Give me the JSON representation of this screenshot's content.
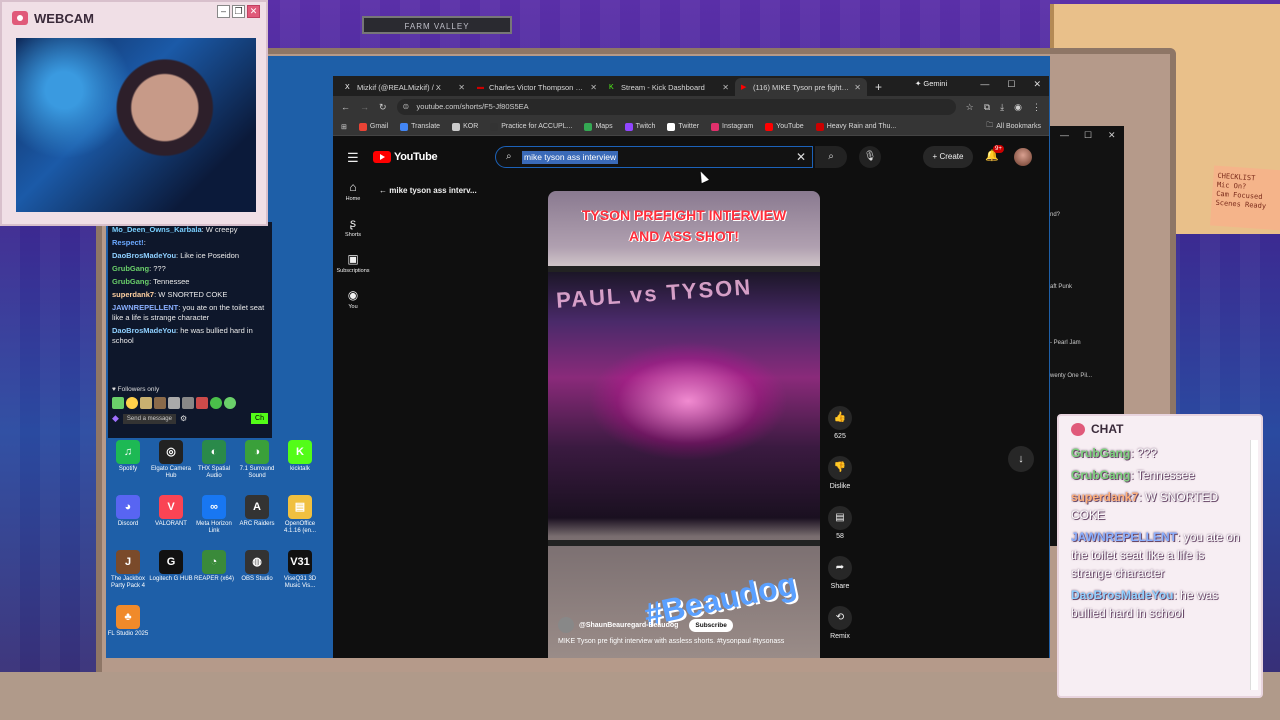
{
  "webcam": {
    "title": "WEBCAM"
  },
  "shelf_sign": "FARM VALLEY",
  "sticky_note": "CHECKLIST\nMic On?\nCam Focused\nScenes Ready",
  "browser": {
    "tabs": [
      {
        "label": "Mizkif (@REALMizkif) / X",
        "favicon": "X",
        "color": "#ffffff",
        "active": false
      },
      {
        "label": "Charles Victor Thompson Beco",
        "favicon": "▬",
        "color": "#cc0000",
        "active": false
      },
      {
        "label": "Stream - Kick Dashboard",
        "favicon": "K",
        "color": "#53fc18",
        "active": false
      },
      {
        "label": "(116) MIKE Tyson pre fight inte",
        "favicon": "▶",
        "color": "#ff0000",
        "active": true
      }
    ],
    "gemini_label": "Gemini",
    "url": "youtube.com/shorts/F5-Jf80S5EA",
    "bookmarks": [
      {
        "label": "Gmail",
        "color": "#ea4335"
      },
      {
        "label": "Translate",
        "color": "#4285f4"
      },
      {
        "label": "KOR",
        "color": "#cccccc"
      },
      {
        "label": "Practice for ACCUPL...",
        "color": "#333333"
      },
      {
        "label": "Maps",
        "color": "#34a853"
      },
      {
        "label": "Twitch",
        "color": "#9146ff"
      },
      {
        "label": "Twitter",
        "color": "#ffffff"
      },
      {
        "label": "Instagram",
        "color": "#e1306c"
      },
      {
        "label": "YouTube",
        "color": "#ff0000"
      },
      {
        "label": "Heavy Rain and Thu...",
        "color": "#cc0000"
      }
    ],
    "all_bookmarks": "All Bookmarks"
  },
  "youtube": {
    "logo": "YouTube",
    "search_query": "mike tyson ass interview",
    "create_label": "Create",
    "notif_badge": "9+",
    "nav": [
      {
        "label": "Home",
        "icon": "⌂"
      },
      {
        "label": "Shorts",
        "icon": "ʂ"
      },
      {
        "label": "Subscriptions",
        "icon": "▣"
      },
      {
        "label": "You",
        "icon": "◉"
      }
    ],
    "back_title": "mike tyson ass interv...",
    "short": {
      "caption_line1": "TYSON PREFIGHT INTERVIEW",
      "caption_line2": "AND ASS SHOT!",
      "arena_text": "PAUL vs TYSON",
      "watermark": "#Beaudog",
      "channel": "@ShaunBeauregard-Beaudog",
      "subscribe": "Subscribe",
      "title": "MIKE Tyson pre fight interview with assless shorts. #tysonpaul #tysonass"
    },
    "actions": [
      {
        "name": "like",
        "icon": "👍",
        "label": "625"
      },
      {
        "name": "dislike",
        "icon": "👎",
        "label": "Dislike"
      },
      {
        "name": "comments",
        "icon": "▤",
        "label": "58"
      },
      {
        "name": "share",
        "icon": "➦",
        "label": "Share"
      },
      {
        "name": "remix",
        "icon": "⟲",
        "label": "Remix"
      }
    ]
  },
  "bg_window": {
    "lines": [
      "nd?",
      "aft Punk",
      "- Pearl Jam",
      "wenty One Pil..."
    ]
  },
  "left_chat": {
    "lines": [
      {
        "name": "Mo_Deen_Owns_Karbala",
        "color": "#7ad0ff",
        "text": "W creepy"
      },
      {
        "name": "Respect!",
        "color": "#6aa8ff",
        "text": ""
      },
      {
        "name": "DaoBrosMadeYou",
        "color": "#8fd0ff",
        "text": "Like ice Poseidon"
      },
      {
        "name": "GrubGang",
        "color": "#6ad06a",
        "text": "???"
      },
      {
        "name": "GrubGang",
        "color": "#6ad06a",
        "text": "Tennessee"
      },
      {
        "name": "superdank7",
        "color": "#ffd0a0",
        "text": "W SNORTED COKE"
      },
      {
        "name": "JAWNREPELLENT",
        "color": "#8ab0ff",
        "text": "you ate on the toilet seat like a life is strange character"
      },
      {
        "name": "DaoBrosMadeYou",
        "color": "#8fd0ff",
        "text": "he was bullied hard in school"
      }
    ],
    "followers_only": "Followers only",
    "send_placeholder": "Send a message",
    "chat_button": "Ch"
  },
  "desktop_icons": [
    {
      "label": "Spotify",
      "color": "#1db954",
      "glyph": "♫"
    },
    {
      "label": "Elgato Camera Hub",
      "color": "#222222",
      "glyph": "◎"
    },
    {
      "label": "THX Spatial Audio",
      "color": "#2a8a4a",
      "glyph": "◐"
    },
    {
      "label": "7.1 Surround Sound",
      "color": "#3aa03a",
      "glyph": "◑"
    },
    {
      "label": "kicktalk",
      "color": "#53fc18",
      "glyph": "K"
    },
    {
      "label": "Discord",
      "color": "#5865f2",
      "glyph": "◕"
    },
    {
      "label": "VALORANT",
      "color": "#fa4454",
      "glyph": "V"
    },
    {
      "label": "Meta Horizon Link",
      "color": "#1877f2",
      "glyph": "∞"
    },
    {
      "label": "ARC Raiders",
      "color": "#333333",
      "glyph": "A"
    },
    {
      "label": "OpenOffice 4.1.16 (en...",
      "color": "#f0c040",
      "glyph": "▤"
    },
    {
      "label": "The Jackbox Party Pack 4",
      "color": "#7a4a2a",
      "glyph": "J"
    },
    {
      "label": "Logitech G HUB",
      "color": "#111111",
      "glyph": "G"
    },
    {
      "label": "REAPER (x64)",
      "color": "#3a8a3a",
      "glyph": "◔"
    },
    {
      "label": "OBS Studio",
      "color": "#333333",
      "glyph": "◍"
    },
    {
      "label": "ViseQ31 3D Music Vis...",
      "color": "#111111",
      "glyph": "V31"
    },
    {
      "label": "FL Studio 2025",
      "color": "#f08a2a",
      "glyph": "♣"
    }
  ],
  "right_chat": {
    "title": "CHAT",
    "lines": [
      {
        "name": "GrubGang",
        "color": "#7ad07a",
        "text": "???"
      },
      {
        "name": "GrubGang",
        "color": "#7ad07a",
        "text": "Tennessee"
      },
      {
        "name": "superdank7",
        "color": "#ffb07a",
        "text": "W SNORTED COKE"
      },
      {
        "name": "JAWNREPELLENT",
        "color": "#8ab0ff",
        "text": "you ate on the toilet seat like a life is strange character"
      },
      {
        "name": "DaoBrosMadeYou",
        "color": "#8fd0ff",
        "text": "he was bullied hard in school"
      }
    ]
  }
}
